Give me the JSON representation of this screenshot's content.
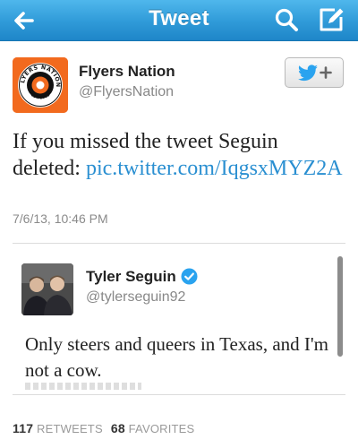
{
  "nav": {
    "title": "Tweet",
    "back_icon": "arrow-left-icon",
    "search_icon": "search-icon",
    "compose_icon": "compose-icon"
  },
  "tweet": {
    "author_name": "Flyers Nation",
    "author_handle": "@FlyersNation",
    "avatar_text": "FLYERS NATION",
    "avatar_est": "EST. 2011",
    "text_prefix": "If you missed the tweet Seguin deleted: ",
    "link_text": "pic.twitter.com/IqgsxMYZ2A",
    "timestamp": "7/6/13, 10:46 PM",
    "follow_button_icon": "twitter-bird-plus-icon"
  },
  "embedded": {
    "name": "Tyler Seguin",
    "handle": "@tylerseguin92",
    "text": "Only steers and queers in Texas, and I'm not a cow.",
    "verified_icon": "verified-badge-icon"
  },
  "stats": {
    "retweets_count": "117",
    "retweets_label": "RETWEETS",
    "favorites_count": "68",
    "favorites_label": "FAVORITES"
  },
  "colors": {
    "nav_bar": "#2f9ad8",
    "link": "#2a8fd1",
    "avatar_orange": "#f26a1e",
    "verified": "#2aa3ef"
  }
}
